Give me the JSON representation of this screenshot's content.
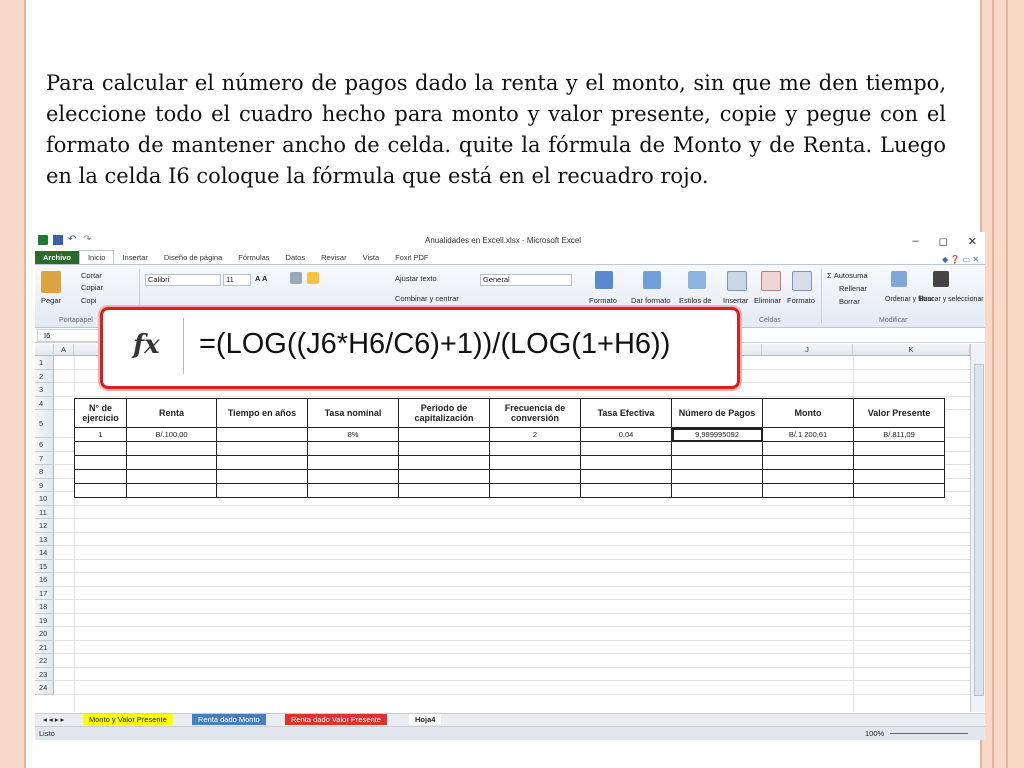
{
  "intro_text": "Para calcular el número de pagos dado la renta y el monto, sin que me den tiempo, eleccione todo el cuadro hecho para monto y valor presente, copie y pegue con el formato de mantener ancho de celda. quite la fórmula de Monto y de Renta.  Luego en la celda I6 coloque la fórmula que está en el recuadro rojo.",
  "window": {
    "title": "Anualidades en Excell.xlsx - Microsoft Excel",
    "controls": [
      "–",
      "◻",
      "✕"
    ]
  },
  "tabs": [
    "Archivo",
    "Inicio",
    "Insertar",
    "Diseño de página",
    "Fórmulas",
    "Datos",
    "Revisar",
    "Vista",
    "Foxit PDF"
  ],
  "ribbon": {
    "paste": "Pegar",
    "cut": "Cortar",
    "copy": "Copiar",
    "copy_format": "Copi",
    "clipboard_group": "Portapapel",
    "font_name": "Calibri",
    "font_size": "11",
    "wrap_text": "Ajustar texto",
    "merge": "Combinar y centrar",
    "number_format": "General",
    "cond_format": "Formato",
    "table_format": "Dar formato",
    "cell_styles": "Estilos de",
    "insert": "Insertar",
    "delete": "Eliminar",
    "format": "Formato",
    "cells_group": "Celdas",
    "autosum": "Autosuma",
    "fill": "Rellenar",
    "clear": "Borrar",
    "sort_filter": "Ordenar y filtrar",
    "find_select": "Buscar y seleccionar",
    "modify_group": "Modificar"
  },
  "name_box": "I6",
  "formula_callout": {
    "fx": "fx",
    "formula": "=(LOG((J6*H6/C6)+1))/(LOG(1+H6))"
  },
  "columns": [
    "A",
    "",
    "",
    "",
    "",
    "",
    "",
    "",
    "",
    "J",
    "K"
  ],
  "rows": [
    "1",
    "2",
    "3",
    "4",
    "5",
    "6",
    "7",
    "8",
    "9",
    "10",
    "11",
    "12",
    "13",
    "14",
    "15",
    "16",
    "17",
    "18",
    "19",
    "20",
    "21",
    "22",
    "23",
    "24"
  ],
  "table": {
    "headers": [
      "N° de ejercicio",
      "Renta",
      "Tiempo en años",
      "Tasa nominal",
      "Periodo de capitalización",
      "Frecuencia de conversión",
      "Tasa Efectiva",
      "Número de Pagos",
      "Monto",
      "Valor Presente"
    ],
    "row6": [
      "1",
      "B/.100,00",
      "",
      "8%",
      "",
      "2",
      "0,04",
      "9,999995092",
      "B/.1 200,61",
      "B/.811,09"
    ]
  },
  "sheet_tabs": [
    "Monto y Valor Presente",
    "Renta dado Monto",
    "Renta dado Valor Presente",
    "Hoja4"
  ],
  "status": {
    "ready": "Listo",
    "zoom": "100%"
  },
  "colors": {
    "file_tab": "#2a6a2a",
    "callout_border": "#d92020",
    "tab_yellow": "#ffff00",
    "tab_blue": "#4a7ebb",
    "tab_red": "#e03030"
  }
}
